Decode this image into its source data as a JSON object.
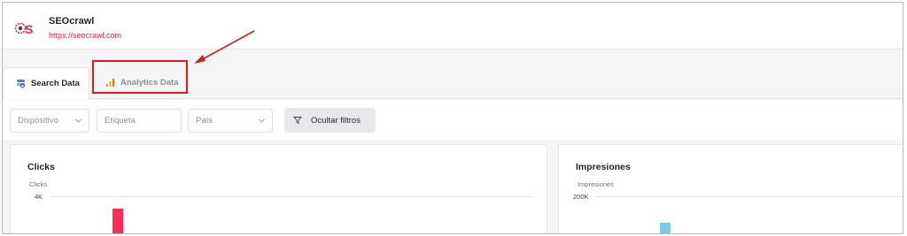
{
  "site": {
    "name": "SEOcrawl",
    "url": "https://seocrawl.com",
    "brand_color": "#e0284f"
  },
  "tabs": [
    {
      "label": "Search Data",
      "icon": "search-console-icon",
      "active": true
    },
    {
      "label": "Analytics Data",
      "icon": "analytics-bars-icon",
      "active": false
    }
  ],
  "filters": {
    "device_placeholder": "Dispositivo",
    "tag_placeholder": "Etiqueta",
    "country_placeholder": "País",
    "toggle_label": "Ocultar filtros"
  },
  "cards": {
    "clicks": {
      "title": "Clicks",
      "axis_label": "Clicks",
      "top_tick": "4K",
      "bar_color": "#ff2d55"
    },
    "impressions": {
      "title": "Impresiones",
      "axis_label": "Impresiones",
      "top_tick": "200K",
      "bar_color": "#7ccbe6"
    }
  },
  "annotation_color": "#e0191e"
}
